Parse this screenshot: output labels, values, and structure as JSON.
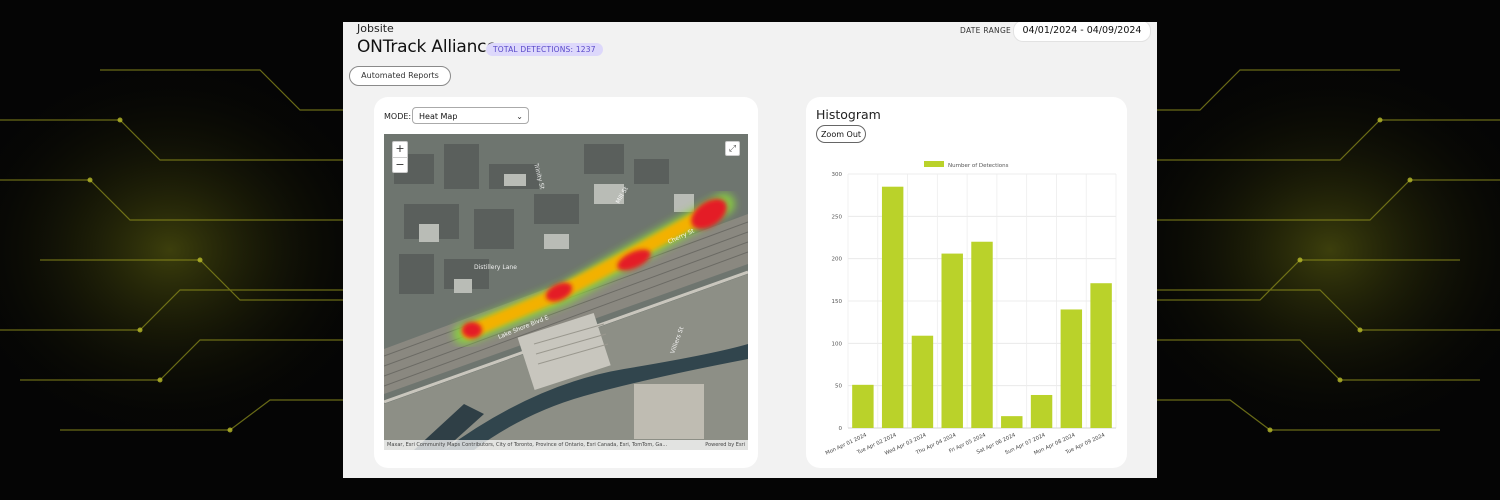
{
  "header": {
    "jobsite_label": "Jobsite",
    "title": "ONTrack Alliance",
    "detections_badge": "TOTAL DETECTIONS: 1237",
    "date_range_label": "DATE RANGE",
    "date_range_value": "04/01/2024 - 04/09/2024",
    "reports_button": "Automated Reports"
  },
  "map_panel": {
    "mode_label": "MODE:",
    "mode_value": "Heat Map",
    "zoom_in": "+",
    "zoom_out": "−",
    "attribution": "Maxar, Esri Community Maps Contributors, City of Toronto, Province of Ontario, Esri Canada, Esri, TomTom, Ga...",
    "powered_by": "Powered by Esri",
    "street_labels": [
      "Lake Shore Blvd E",
      "Cherry St",
      "Mill St",
      "Distillery Lane",
      "Trinity St",
      "Villiers St"
    ],
    "accent_colors": {
      "heat_high": "#e8202a",
      "heat_mid": "#f5b400",
      "heat_low": "#7ed23a"
    }
  },
  "histogram": {
    "title": "Histogram",
    "zoom_out_button": "Zoom Out"
  },
  "chart_data": {
    "type": "bar",
    "title": "",
    "legend": [
      "Number of Detections"
    ],
    "legend_position": "top",
    "categories": [
      "Mon Apr 01 2024",
      "Tue Apr 02 2024",
      "Wed Apr 03 2024",
      "Thu Apr 04 2024",
      "Fri Apr 05 2024",
      "Sat Apr 06 2024",
      "Sun Apr 07 2024",
      "Mon Apr 08 2024",
      "Tue Apr 09 2024"
    ],
    "series": [
      {
        "name": "Number of Detections",
        "values": [
          51,
          285,
          109,
          206,
          220,
          14,
          39,
          140,
          171
        ],
        "color": "#bad22a"
      }
    ],
    "ylim": [
      0,
      300
    ],
    "yticks": [
      0,
      50,
      100,
      150,
      200,
      250,
      300
    ],
    "grid": true,
    "xlabel": "",
    "ylabel": ""
  }
}
